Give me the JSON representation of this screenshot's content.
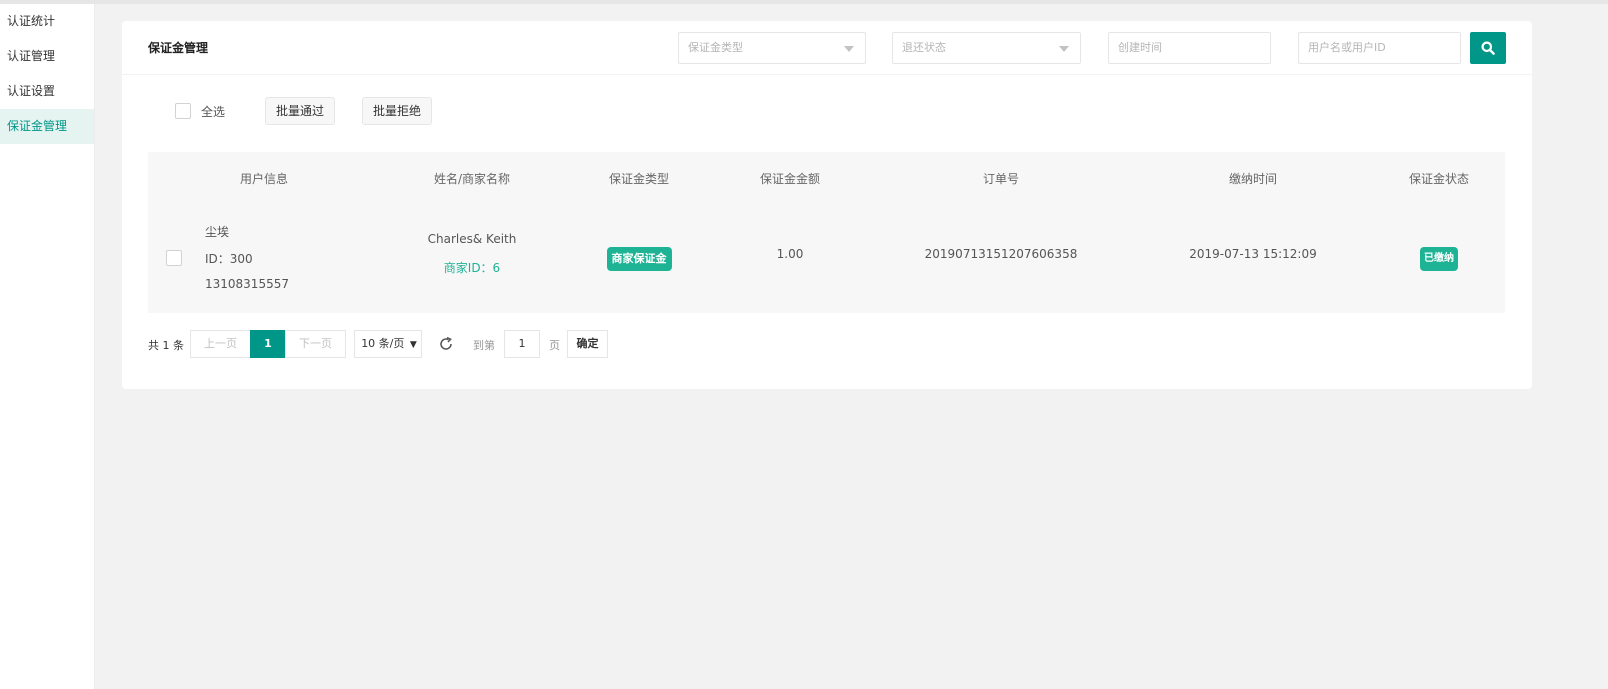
{
  "sidebar": {
    "items": [
      {
        "label": "认证统计"
      },
      {
        "label": "认证管理"
      },
      {
        "label": "认证设置"
      },
      {
        "label": "保证金管理",
        "active": true
      }
    ]
  },
  "header": {
    "title": "保证金管理",
    "filters": {
      "deposit_type_placeholder": "保证金类型",
      "refund_status_placeholder": "退还状态",
      "created_time_placeholder": "创建时间",
      "user_placeholder": "用户名或用户ID"
    },
    "search_icon": "search-icon"
  },
  "batch": {
    "select_all": "全选",
    "approve": "批量通过",
    "reject": "批量拒绝"
  },
  "table": {
    "columns": [
      "用户信息",
      "姓名/商家名称",
      "保证金类型",
      "保证金金额",
      "订单号",
      "缴纳时间",
      "保证金状态"
    ],
    "rows": [
      {
        "user_name": "尘埃",
        "user_id": "ID：300",
        "phone": "13108315557",
        "merchant_name": "Charles& Keith",
        "merchant_id": "商家ID：6",
        "deposit_type": "商家保证金",
        "amount": "1.00",
        "order_no": "20190713151207606358",
        "paid_time": "2019-07-13 15:12:09",
        "status": "已缴纳"
      }
    ]
  },
  "pagination": {
    "total": "共 1 条",
    "prev": "上一页",
    "current": "1",
    "next": "下一页",
    "page_size": "10 条/页",
    "goto_label": "到第",
    "goto_value": "1",
    "page_unit": "页",
    "confirm": "确定"
  },
  "colors": {
    "accent": "#009688",
    "tag": "#1fb395"
  }
}
